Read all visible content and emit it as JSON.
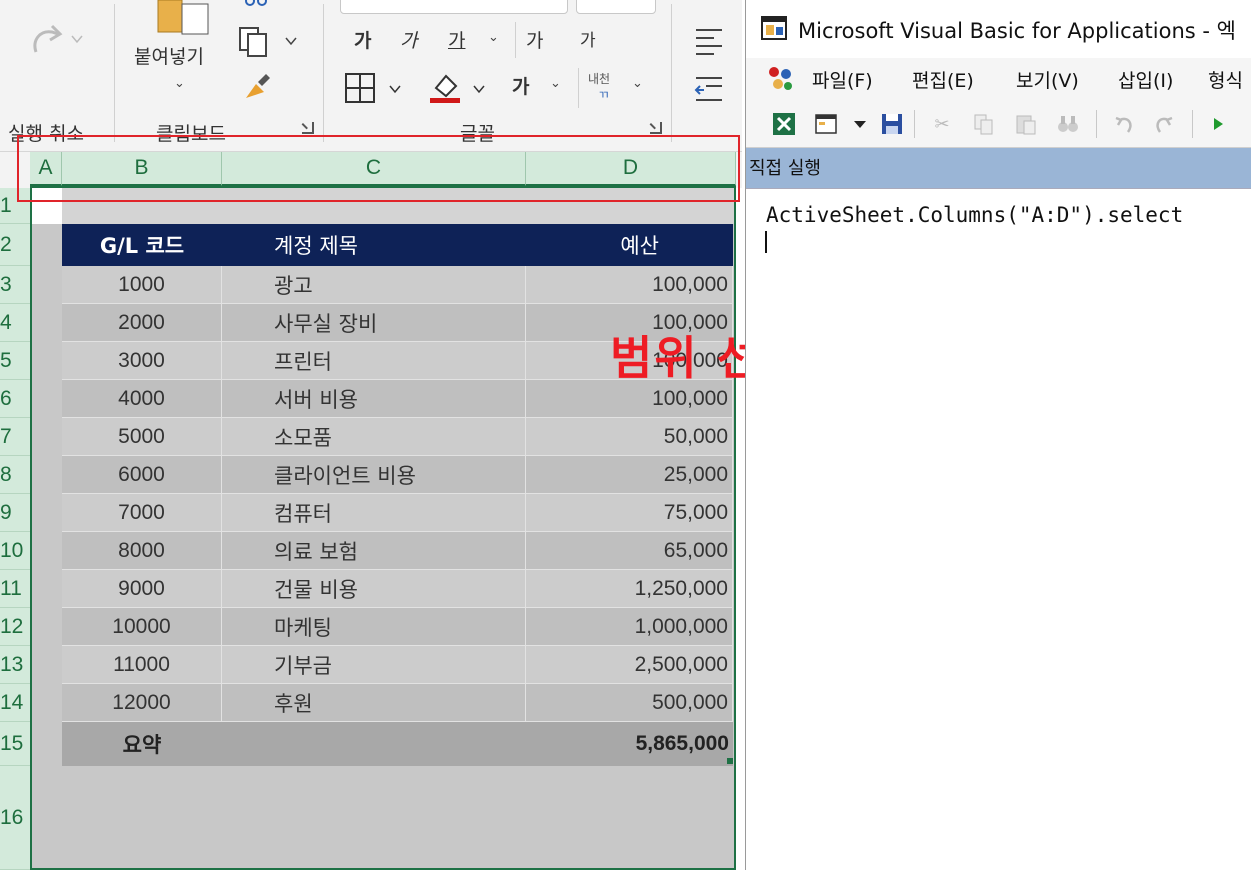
{
  "ribbon": {
    "undo_group_label": "실행 취소",
    "clipboard_group_label": "클립보드",
    "font_group_label": "글꼴",
    "paste_label": "붙여넣기",
    "bold_label": "가",
    "italic_label": "가",
    "underline_label": "가",
    "grow_font_label": "가",
    "shrink_font_label": "가",
    "bold_font_btn_label": "가",
    "phonetic_label": "내천"
  },
  "sheet": {
    "columns": [
      "A",
      "B",
      "C",
      "D"
    ],
    "row_numbers": [
      "1",
      "2",
      "3",
      "4",
      "5",
      "6",
      "7",
      "8",
      "9",
      "10",
      "11",
      "12",
      "13",
      "14",
      "15",
      "16"
    ],
    "header": {
      "code": "G/L 코드",
      "title": "계정 제목",
      "budget": "예산"
    },
    "rows": [
      {
        "code": "1000",
        "title": "광고",
        "budget": "100,000"
      },
      {
        "code": "2000",
        "title": "사무실 장비",
        "budget": "100,000"
      },
      {
        "code": "3000",
        "title": "프린터",
        "budget": "100,000"
      },
      {
        "code": "4000",
        "title": "서버 비용",
        "budget": "100,000"
      },
      {
        "code": "5000",
        "title": "소모품",
        "budget": "50,000"
      },
      {
        "code": "6000",
        "title": "클라이언트 비용",
        "budget": "25,000"
      },
      {
        "code": "7000",
        "title": "컴퓨터",
        "budget": "75,000"
      },
      {
        "code": "8000",
        "title": "의료 보험",
        "budget": "65,000"
      },
      {
        "code": "9000",
        "title": "건물 비용",
        "budget": "1,250,000"
      },
      {
        "code": "10000",
        "title": "마케팅",
        "budget": "1,000,000"
      },
      {
        "code": "11000",
        "title": "기부금",
        "budget": "2,500,000"
      },
      {
        "code": "12000",
        "title": "후원",
        "budget": "500,000"
      }
    ],
    "summary": {
      "label": "요약",
      "total": "5,865,000"
    }
  },
  "annotation": {
    "text": "범위 선택",
    "color": "#ee1c24"
  },
  "vba": {
    "title": "Microsoft Visual Basic for Applications - 엑",
    "menu": [
      "파일(F)",
      "편집(E)",
      "보기(V)",
      "삽입(I)",
      "형식"
    ],
    "immediate_title": "직접 실행",
    "code": "ActiveSheet.Columns(\"A:D\").select"
  },
  "colors": {
    "header_fill": "#0e2257",
    "selection_green": "#1e7145",
    "highlight_red": "#e0242a",
    "immediate_bar": "#9ab5d6"
  }
}
